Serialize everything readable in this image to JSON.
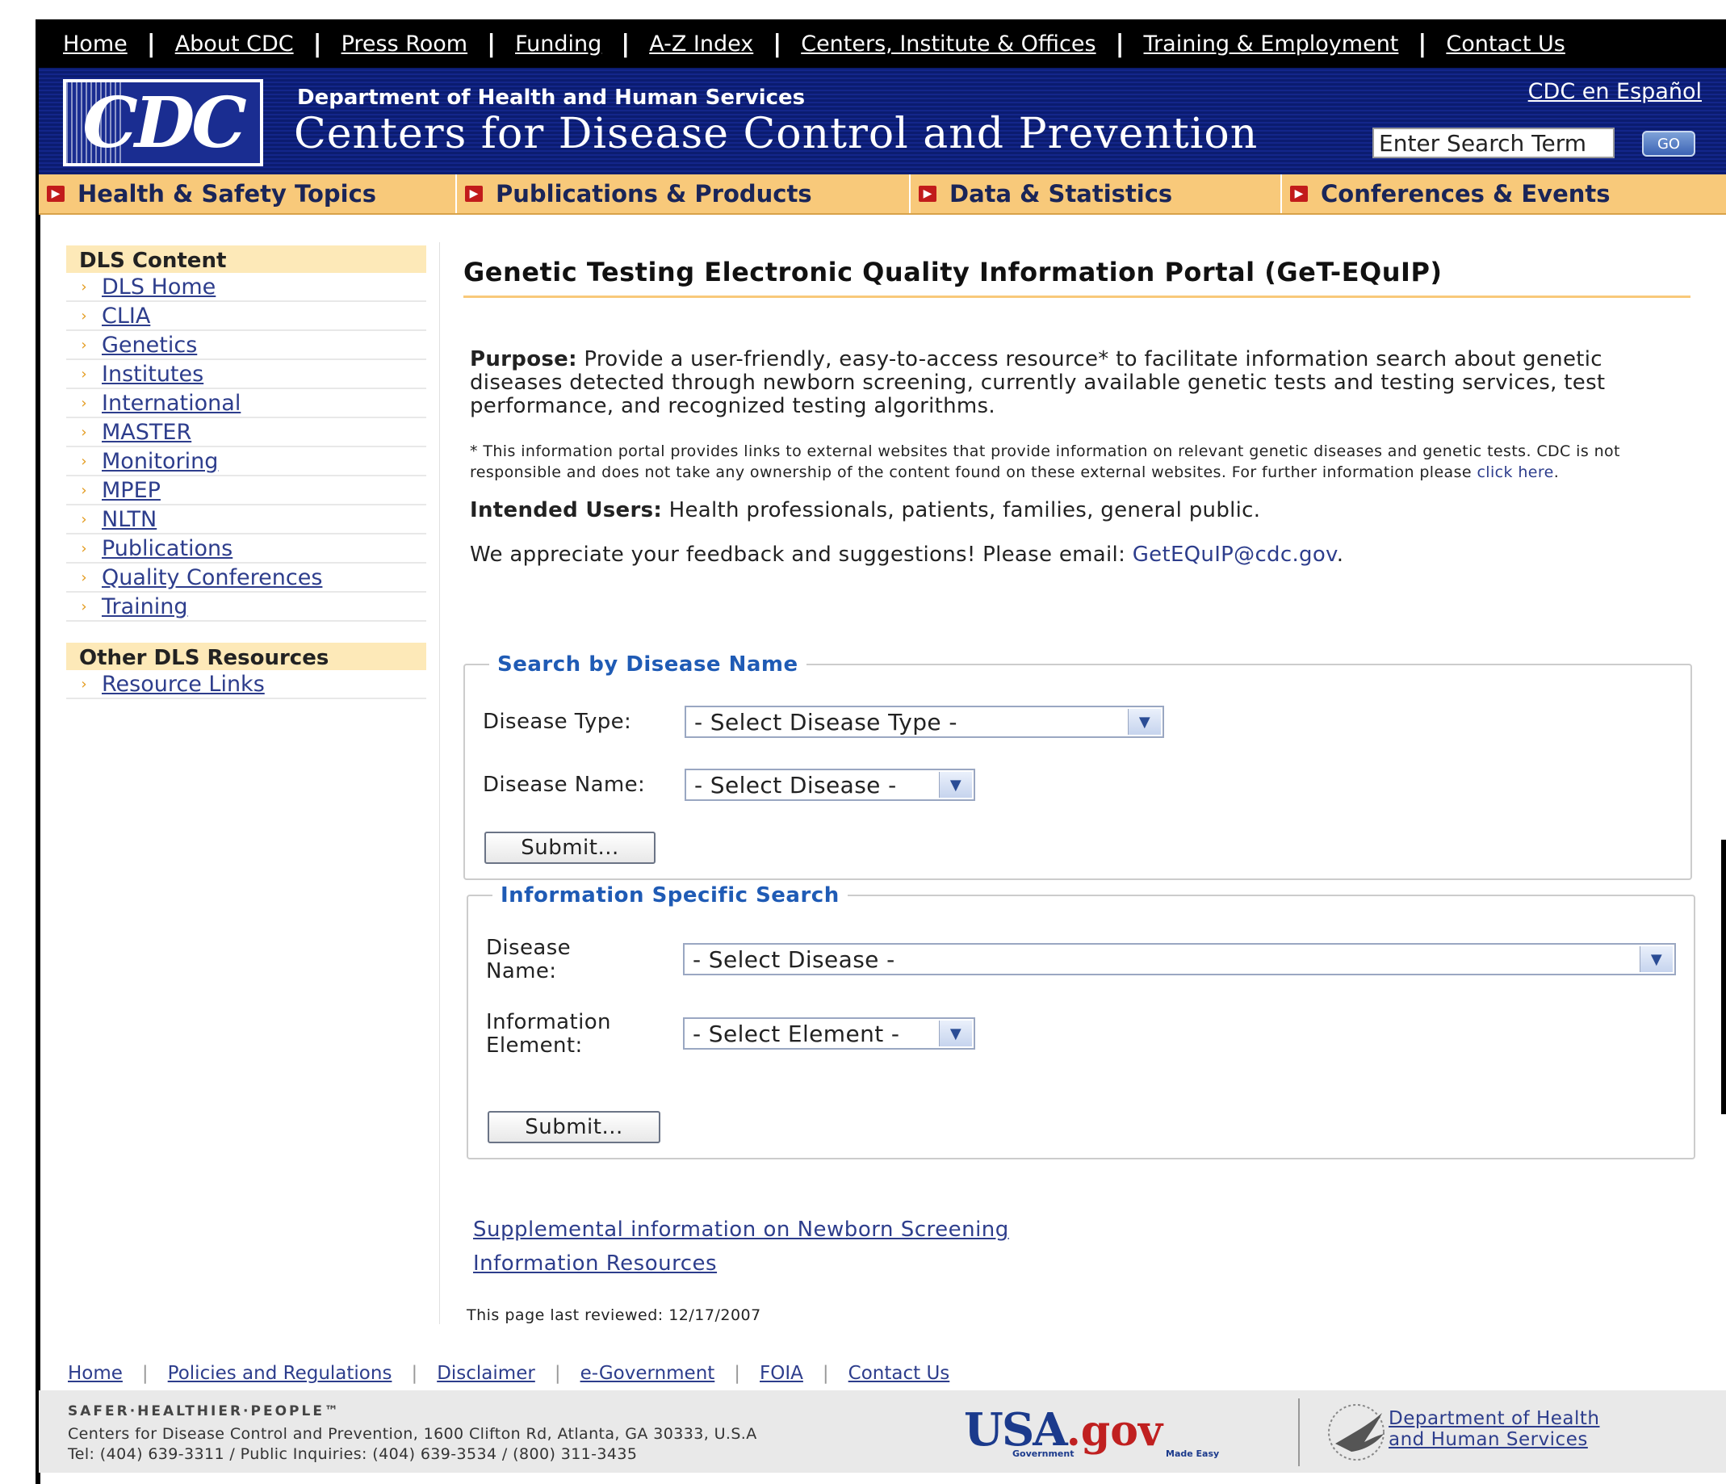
{
  "topnav": {
    "items": [
      "Home",
      "About CDC",
      "Press Room",
      "Funding",
      "A-Z Index",
      "Centers, Institute & Offices",
      "Training & Employment",
      "Contact Us"
    ]
  },
  "header": {
    "logo_text": "CDC",
    "department": "Department of Health and Human Services",
    "agency": "Centers for Disease Control and Prevention",
    "espanol_link": "CDC en Español",
    "search_value": "Enter Search Term",
    "go_label": "GO"
  },
  "topics": [
    "Health & Safety Topics",
    "Publications & Products",
    "Data & Statistics",
    "Conferences & Events"
  ],
  "sidebar": {
    "content_heading": "DLS Content",
    "content_items": [
      "DLS Home",
      "CLIA",
      "Genetics",
      "Institutes",
      "International",
      "MASTER",
      "Monitoring",
      "MPEP",
      "NLTN",
      "Publications",
      "Quality Conferences",
      "Training"
    ],
    "resources_heading": "Other DLS Resources",
    "resources_items": [
      "Resource Links"
    ]
  },
  "main": {
    "title": "Genetic Testing Electronic Quality Information Portal (GeT-EQuIP)",
    "purpose_label": "Purpose:",
    "purpose_text": " Provide a user-friendly, easy-to-access resource* to facilitate information search about genetic diseases detected through newborn screening, currently available genetic tests and testing services, test performance, and recognized testing algorithms.",
    "disclaimer_text": "* This information portal provides links to external websites that provide information on relevant genetic diseases and genetic tests. CDC is not responsible and does not take any ownership of the content found on these external websites. For further information please ",
    "disclaimer_link": "click here",
    "users_label": "Intended Users:",
    "users_text": " Health professionals, patients, families, general public.",
    "feedback_text": "We appreciate your feedback and suggestions! Please email: ",
    "feedback_email": "GetEQuIP@cdc.gov",
    "search_disease": {
      "legend": "Search by Disease Name",
      "type_label": "Disease Type:",
      "type_value": "- Select Disease Type -",
      "name_label": "Disease Name:",
      "name_value": "- Select Disease -",
      "submit": "Submit..."
    },
    "info_search": {
      "legend": "Information Specific Search",
      "disease_label": "Disease Name:",
      "disease_value": "- Select Disease -",
      "element_label": "Information Element:",
      "element_value": "- Select Element -",
      "submit": "Submit..."
    },
    "link_supplemental": "Supplemental information on Newborn Screening",
    "link_resources": "Information Resources",
    "last_reviewed": "This page last reviewed: 12/17/2007"
  },
  "footer": {
    "links": [
      "Home",
      "Policies and Regulations",
      "Disclaimer",
      "e-Government",
      "FOIA",
      "Contact Us"
    ],
    "slogan": "SAFER·HEALTHIER·PEOPLE™",
    "address": "Centers for Disease Control and Prevention, 1600 Clifton Rd, Atlanta, GA 30333, U.S.A",
    "phone": "Tel: (404) 639-3311 / Public Inquiries: (404) 639-3534 / (800) 311-3435",
    "usa_gov": "USA",
    "usa_gov_suffix": ".gov",
    "usa_gov_tag1": "Government",
    "usa_gov_tag2": "Made Easy",
    "hhs_line1": "Department of Health",
    "hhs_line2": "and Human Services"
  }
}
